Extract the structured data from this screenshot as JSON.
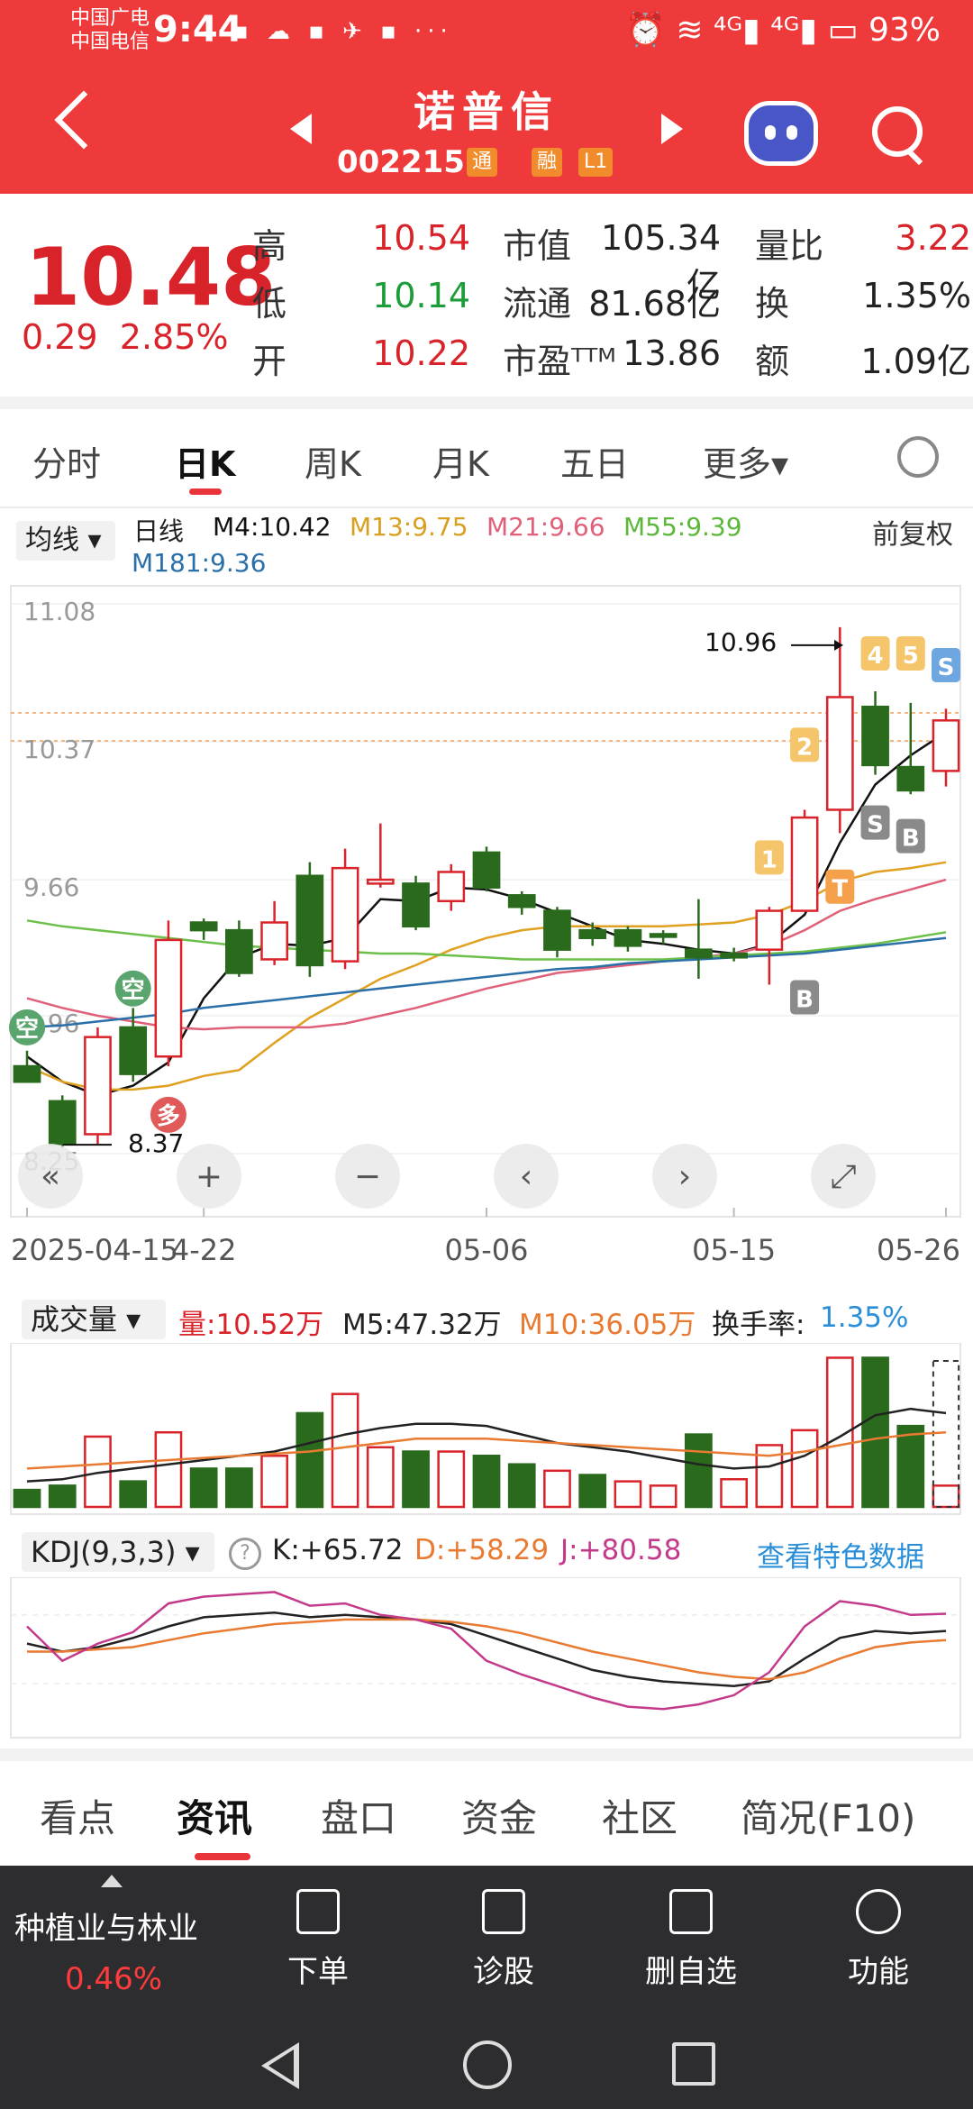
{
  "status": {
    "carrier1": "中国广电",
    "carrier2": "中国电信",
    "time": "9:44",
    "apps": "▪ ☁ ▪ ✈ ▪ ···",
    "right": "⏰ ≋ ⁴ᴳ▮ ⁴ᴳ▮ ▭ 93%",
    "battery": "93%"
  },
  "header": {
    "name": "诺普信",
    "code": "002215",
    "badge_tong": "通",
    "badge_rong": "融",
    "badge_l1": "L1"
  },
  "quote": {
    "price": "10.48",
    "change": "0.29",
    "change_pct": "2.85%",
    "rows": [
      {
        "l1": "高",
        "v1": "10.54",
        "l2": "市值",
        "v2": "105.34亿",
        "l3": "量比",
        "v3": "3.22"
      },
      {
        "l1": "低",
        "v1": "10.14",
        "l2": "流通",
        "v2": "81.68亿",
        "l3": "换",
        "v3": "1.35%"
      },
      {
        "l1": "开",
        "v1": "10.22",
        "l2": "市盈ᵀᵀᴹ",
        "v2": "13.86",
        "l3": "额",
        "v3": "1.09亿"
      }
    ]
  },
  "ktabs": [
    "分时",
    "日K",
    "周K",
    "月K",
    "五日",
    "更多▾"
  ],
  "chart_header": {
    "ma_button": "均线 ▾",
    "line_type": "日线",
    "m4": "M4:10.42",
    "m13": "M13:9.75",
    "m21": "M21:9.66",
    "m55": "M55:9.39",
    "m181": "M181:9.36",
    "adjust": "前复权"
  },
  "colors": {
    "up": "#d9232a",
    "down": "#2a6a1c",
    "m4": "#111111",
    "m13": "#e0a020",
    "m21": "#e0607a",
    "m55": "#6cc04a",
    "m181": "#2a6fa8",
    "accent": "#ee3a3a"
  },
  "chart_data": [
    {
      "type": "candlestick",
      "title": "",
      "yticks": [
        "11.08",
        "10.37",
        "9.66",
        "8.96",
        "8.25"
      ],
      "ylim": [
        8.25,
        11.08
      ],
      "xticks": [
        "2025-04-15",
        "4-22",
        "05-06",
        "05-15",
        "05-26"
      ],
      "annotations": {
        "high": "10.96",
        "low": "8.37",
        "ref_line": "10.37"
      },
      "markers": [
        "多",
        "空",
        "空",
        "1",
        "2",
        "4",
        "5",
        "S",
        "S",
        "B",
        "B",
        "T"
      ],
      "candles": [
        {
          "o": 8.7,
          "h": 8.78,
          "l": 8.62,
          "c": 8.62
        },
        {
          "o": 8.52,
          "h": 8.55,
          "l": 8.28,
          "c": 8.3
        },
        {
          "o": 8.35,
          "h": 8.9,
          "l": 8.3,
          "c": 8.85
        },
        {
          "o": 8.9,
          "h": 9.0,
          "l": 8.62,
          "c": 8.66
        },
        {
          "o": 8.75,
          "h": 9.45,
          "l": 8.7,
          "c": 9.35
        },
        {
          "o": 9.44,
          "h": 9.46,
          "l": 9.35,
          "c": 9.4
        },
        {
          "o": 9.4,
          "h": 9.45,
          "l": 9.16,
          "c": 9.18
        },
        {
          "o": 9.25,
          "h": 9.55,
          "l": 9.22,
          "c": 9.44
        },
        {
          "o": 9.68,
          "h": 9.75,
          "l": 9.16,
          "c": 9.22
        },
        {
          "o": 9.24,
          "h": 9.82,
          "l": 9.2,
          "c": 9.72
        },
        {
          "o": 9.64,
          "h": 9.95,
          "l": 9.62,
          "c": 9.66
        },
        {
          "o": 9.64,
          "h": 9.68,
          "l": 9.4,
          "c": 9.42
        },
        {
          "o": 9.55,
          "h": 9.74,
          "l": 9.5,
          "c": 9.7
        },
        {
          "o": 9.8,
          "h": 9.83,
          "l": 9.6,
          "c": 9.62
        },
        {
          "o": 9.58,
          "h": 9.6,
          "l": 9.48,
          "c": 9.52
        },
        {
          "o": 9.5,
          "h": 9.52,
          "l": 9.26,
          "c": 9.3
        },
        {
          "o": 9.4,
          "h": 9.44,
          "l": 9.32,
          "c": 9.36
        },
        {
          "o": 9.4,
          "h": 9.42,
          "l": 9.29,
          "c": 9.32
        },
        {
          "o": 9.38,
          "h": 9.4,
          "l": 9.33,
          "c": 9.37
        },
        {
          "o": 9.3,
          "h": 9.56,
          "l": 9.15,
          "c": 9.26
        },
        {
          "o": 9.28,
          "h": 9.31,
          "l": 9.24,
          "c": 9.26
        },
        {
          "o": 9.3,
          "h": 9.52,
          "l": 9.12,
          "c": 9.5
        },
        {
          "o": 9.5,
          "h": 10.02,
          "l": 9.5,
          "c": 9.98
        },
        {
          "o": 10.02,
          "h": 10.96,
          "l": 9.9,
          "c": 10.6
        },
        {
          "o": 10.55,
          "h": 10.63,
          "l": 10.2,
          "c": 10.25
        },
        {
          "o": 10.24,
          "h": 10.57,
          "l": 10.1,
          "c": 10.12
        },
        {
          "o": 10.22,
          "h": 10.54,
          "l": 10.14,
          "c": 10.48
        }
      ],
      "ma": {
        "M4": [
          8.75,
          8.62,
          8.55,
          8.6,
          8.72,
          9.05,
          9.26,
          9.33,
          9.32,
          9.36,
          9.56,
          9.55,
          9.62,
          9.61,
          9.56,
          9.49,
          9.42,
          9.35,
          9.33,
          9.3,
          9.28,
          9.33,
          9.48,
          9.85,
          10.15,
          10.3,
          10.42
        ],
        "M13": [
          8.7,
          8.62,
          8.58,
          8.58,
          8.6,
          8.65,
          8.68,
          8.82,
          8.95,
          9.05,
          9.15,
          9.22,
          9.3,
          9.36,
          9.4,
          9.42,
          9.42,
          9.42,
          9.42,
          9.43,
          9.44,
          9.48,
          9.55,
          9.65,
          9.7,
          9.72,
          9.75
        ],
        "M21": [
          9.05,
          9.0,
          8.96,
          8.93,
          8.9,
          8.89,
          8.9,
          8.9,
          8.9,
          8.92,
          8.96,
          9.0,
          9.05,
          9.1,
          9.14,
          9.18,
          9.2,
          9.22,
          9.24,
          9.26,
          9.28,
          9.32,
          9.4,
          9.5,
          9.56,
          9.61,
          9.66
        ],
        "M55": [
          9.45,
          9.42,
          9.4,
          9.38,
          9.36,
          9.34,
          9.32,
          9.31,
          9.3,
          9.29,
          9.28,
          9.28,
          9.27,
          9.26,
          9.25,
          9.25,
          9.25,
          9.25,
          9.25,
          9.26,
          9.27,
          9.28,
          9.29,
          9.31,
          9.33,
          9.36,
          9.39
        ],
        "M181": [
          8.9,
          8.91,
          8.93,
          8.95,
          8.97,
          9.0,
          9.02,
          9.04,
          9.06,
          9.08,
          9.1,
          9.12,
          9.14,
          9.16,
          9.18,
          9.2,
          9.21,
          9.23,
          9.24,
          9.25,
          9.26,
          9.27,
          9.28,
          9.3,
          9.32,
          9.34,
          9.36
        ]
      }
    },
    {
      "type": "bar",
      "title": "",
      "values": [
        0.8,
        1.0,
        3.3,
        1.2,
        3.5,
        1.8,
        1.8,
        2.4,
        4.4,
        5.3,
        2.8,
        2.6,
        2.6,
        2.4,
        2.0,
        1.7,
        1.5,
        1.2,
        1.0,
        3.4,
        1.3,
        2.9,
        3.6,
        7.0,
        7.0,
        3.8,
        1.0
      ],
      "up": [
        false,
        false,
        true,
        false,
        true,
        false,
        false,
        true,
        false,
        true,
        true,
        false,
        true,
        false,
        false,
        true,
        false,
        true,
        true,
        false,
        true,
        true,
        true,
        true,
        false,
        false,
        true
      ],
      "ma": {
        "M5": [
          1.2,
          1.3,
          1.6,
          1.8,
          2.0,
          2.2,
          2.4,
          2.6,
          3.0,
          3.4,
          3.7,
          3.9,
          3.9,
          3.8,
          3.4,
          3.0,
          2.8,
          2.6,
          2.3,
          2.0,
          1.8,
          1.9,
          2.4,
          3.3,
          4.3,
          4.6,
          4.4
        ],
        "M10": [
          1.8,
          1.9,
          2.0,
          2.1,
          2.2,
          2.3,
          2.4,
          2.5,
          2.6,
          2.8,
          3.0,
          3.2,
          3.2,
          3.2,
          3.1,
          3.0,
          2.9,
          2.8,
          2.7,
          2.6,
          2.5,
          2.4,
          2.6,
          2.9,
          3.2,
          3.4,
          3.5
        ]
      }
    },
    {
      "type": "line",
      "title": "",
      "series": [
        {
          "name": "K",
          "values": [
            55,
            48,
            52,
            60,
            70,
            78,
            80,
            82,
            78,
            80,
            78,
            76,
            72,
            62,
            52,
            42,
            32,
            26,
            22,
            20,
            18,
            22,
            42,
            60,
            66,
            64,
            66
          ]
        },
        {
          "name": "D",
          "values": [
            48,
            48,
            50,
            52,
            58,
            64,
            68,
            72,
            74,
            76,
            76,
            76,
            74,
            70,
            64,
            56,
            48,
            42,
            36,
            30,
            26,
            24,
            30,
            42,
            52,
            56,
            58
          ]
        },
        {
          "name": "J",
          "values": [
            70,
            40,
            55,
            65,
            90,
            96,
            98,
            100,
            88,
            90,
            80,
            76,
            68,
            40,
            28,
            18,
            8,
            0,
            -2,
            2,
            10,
            30,
            70,
            92,
            88,
            80,
            81
          ]
        }
      ]
    }
  ],
  "volume_header": {
    "button": "成交量 ▾",
    "vol": "量:10.52万",
    "m5": "M5:47.32万",
    "m10": "M10:36.05万",
    "turnover_label": "换手率:",
    "turnover": "1.35%"
  },
  "kdj_header": {
    "button": "KDJ(9,3,3) ▾",
    "help": "?",
    "k": "K:+65.72",
    "d": "D:+58.29",
    "j": "J:+80.58",
    "link": "查看特色数据"
  },
  "news_tabs": [
    "看点",
    "资讯",
    "盘口",
    "资金",
    "社区",
    "简况(F10)"
  ],
  "dock": {
    "sector": "种植业与林业",
    "sector_pct": "0.46%",
    "items": [
      "下单",
      "诊股",
      "删自选",
      "功能"
    ]
  }
}
